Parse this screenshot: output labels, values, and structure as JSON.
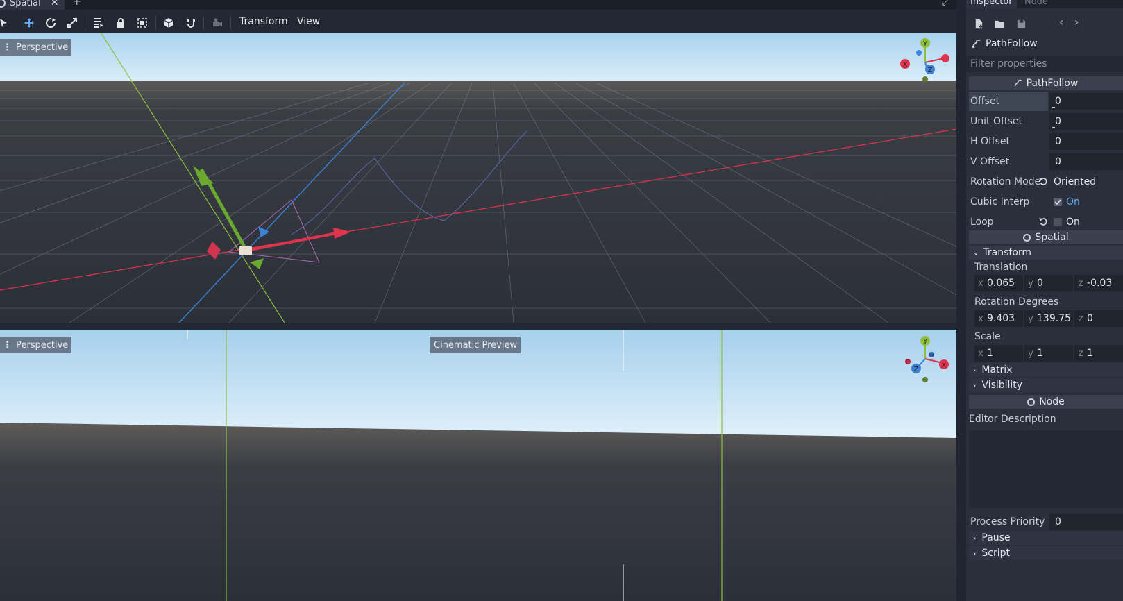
{
  "scene_tabs": {
    "active": "Spatial",
    "add_symbol": "+"
  },
  "toolbar": {
    "menus": [
      "Transform",
      "View"
    ]
  },
  "viewports": {
    "top": {
      "label": "Perspective",
      "gizmo_axes": {
        "x": "X",
        "y": "Y",
        "z": "Z"
      }
    },
    "bottom": {
      "label": "Perspective",
      "cinematic": "Cinematic Preview",
      "gizmo_axes": {
        "x": "X",
        "y": "Y",
        "z": "Z"
      }
    }
  },
  "inspector": {
    "tabs": [
      "Inspector",
      "Node"
    ],
    "node_name": "PathFollow",
    "filter_placeholder": "Filter properties",
    "pathfollow": {
      "header": "PathFollow",
      "offset": {
        "label": "Offset",
        "value": "0"
      },
      "unit_offset": {
        "label": "Unit Offset",
        "value": "0"
      },
      "h_offset": {
        "label": "H Offset",
        "value": "0"
      },
      "v_offset": {
        "label": "V Offset",
        "value": "0"
      },
      "rotation_mode": {
        "label": "Rotation Mode",
        "value": "Oriented"
      },
      "cubic_interp": {
        "label": "Cubic Interp",
        "value": "On"
      },
      "loop": {
        "label": "Loop",
        "value": "On"
      }
    },
    "spatial": {
      "header": "Spatial",
      "transform": "Transform",
      "translation": {
        "label": "Translation",
        "x": "0.065",
        "y": "0",
        "z": "-0.03"
      },
      "rotation": {
        "label": "Rotation Degrees",
        "x": "9.403",
        "y": "139.75",
        "z": "0"
      },
      "scale": {
        "label": "Scale",
        "x": "1",
        "y": "1",
        "z": "1"
      },
      "axis_labels": {
        "x": "x",
        "y": "y",
        "z": "z"
      },
      "matrix": "Matrix",
      "visibility": "Visibility"
    },
    "node": {
      "header": "Node",
      "editor_description": "Editor Description",
      "process_priority": {
        "label": "Process Priority",
        "value": "0"
      },
      "pause": "Pause",
      "script": "Script"
    }
  },
  "colors": {
    "axis_x": "#e0344c",
    "axis_y": "#8fbf3a",
    "axis_z": "#3b82d6",
    "accent": "#6aa9e8"
  }
}
